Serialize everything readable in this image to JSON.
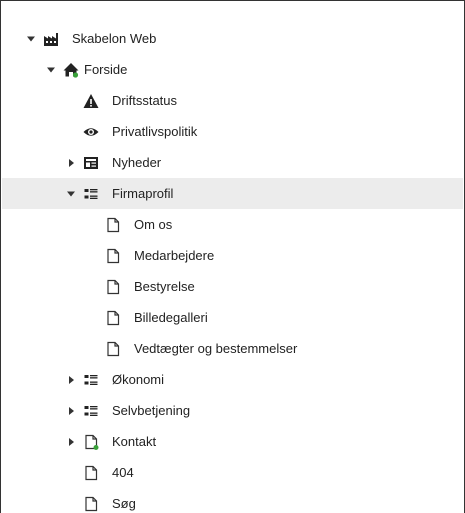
{
  "tree": {
    "root": {
      "label": "Skabelon Web",
      "icon": "factory-icon"
    },
    "forside": {
      "label": "Forside",
      "icon": "home-icon"
    },
    "items": [
      {
        "key": "driftsstatus",
        "label": "Driftsstatus",
        "icon": "warning-icon"
      },
      {
        "key": "privatlivspolitik",
        "label": "Privatlivspolitik",
        "icon": "eye-icon"
      },
      {
        "key": "nyheder",
        "label": "Nyheder",
        "icon": "newspaper-icon"
      },
      {
        "key": "firmaprofil",
        "label": "Firmaprofil",
        "icon": "list-icon"
      },
      {
        "key": "om-os",
        "label": "Om os",
        "icon": "page-icon"
      },
      {
        "key": "medarbejdere",
        "label": "Medarbejdere",
        "icon": "page-icon"
      },
      {
        "key": "bestyrelse",
        "label": "Bestyrelse",
        "icon": "page-icon"
      },
      {
        "key": "billedegalleri",
        "label": "Billedegalleri",
        "icon": "page-icon"
      },
      {
        "key": "vedtaegter",
        "label": "Vedtægter og bestemmelser",
        "icon": "page-icon"
      },
      {
        "key": "okonomi",
        "label": "Økonomi",
        "icon": "list-icon"
      },
      {
        "key": "selvbetjening",
        "label": "Selvbetjening",
        "icon": "list-icon"
      },
      {
        "key": "kontakt",
        "label": "Kontakt",
        "icon": "page-link-icon"
      },
      {
        "key": "404",
        "label": "404",
        "icon": "page-icon"
      },
      {
        "key": "sog",
        "label": "Søg",
        "icon": "page-icon"
      }
    ]
  },
  "colors": {
    "selected_row": "#ececec",
    "accent_green": "#3aa13a"
  }
}
